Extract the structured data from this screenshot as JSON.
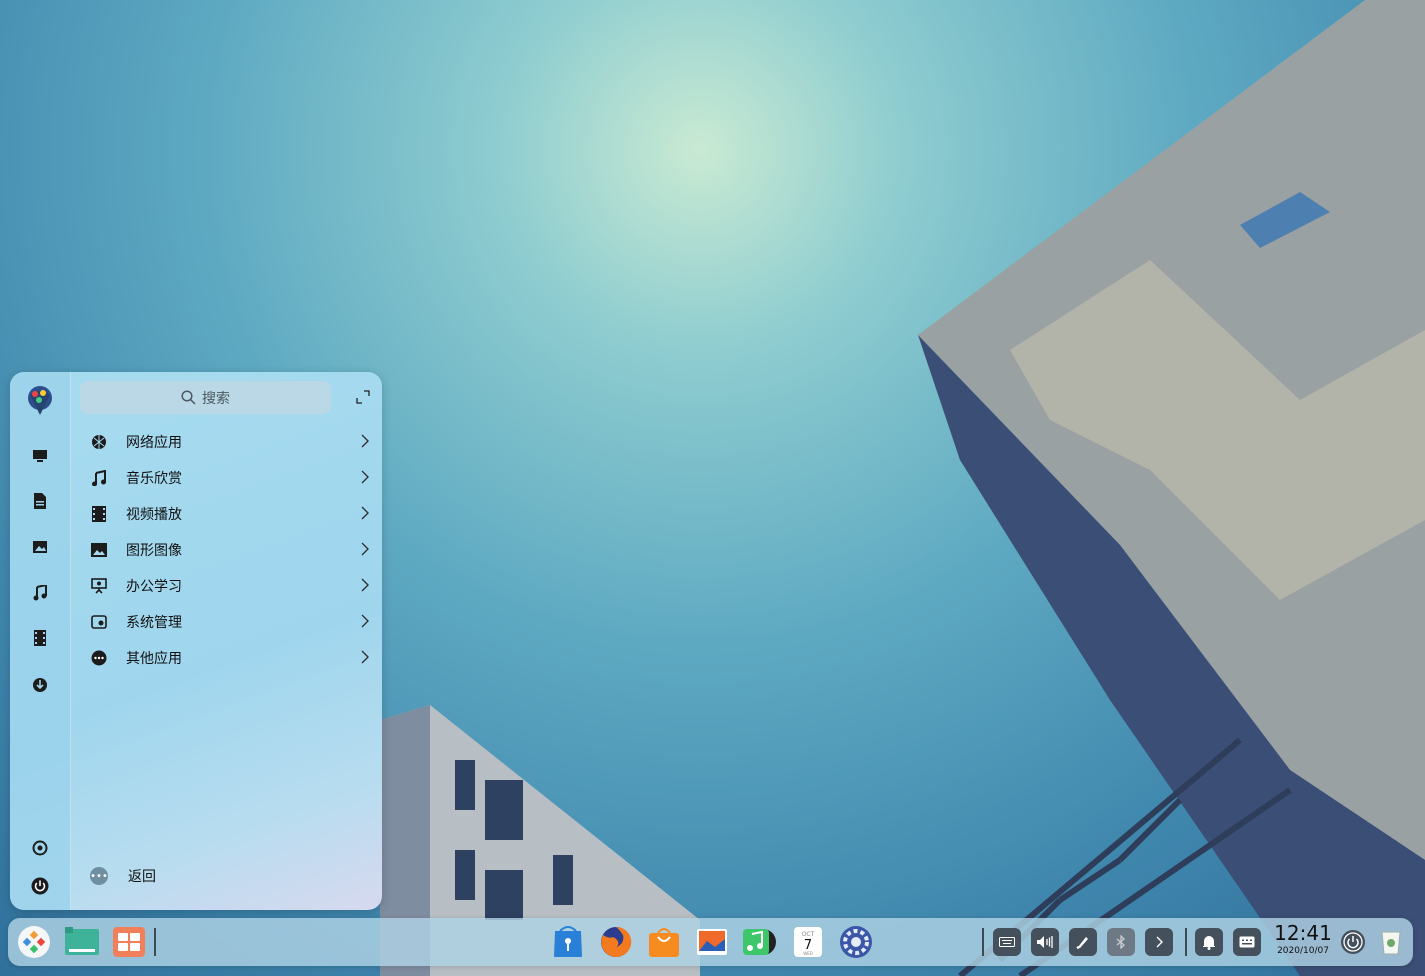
{
  "launcher": {
    "search_placeholder": "搜索",
    "categories": [
      {
        "label": "网络应用",
        "icon": "globe-icon"
      },
      {
        "label": "音乐欣赏",
        "icon": "music-note-icon"
      },
      {
        "label": "视频播放",
        "icon": "film-icon"
      },
      {
        "label": "图形图像",
        "icon": "image-icon"
      },
      {
        "label": "办公学习",
        "icon": "presentation-icon"
      },
      {
        "label": "系统管理",
        "icon": "system-settings-icon"
      },
      {
        "label": "其他应用",
        "icon": "more-dots-icon"
      }
    ],
    "back_label": "返回",
    "sidebar": [
      "computer-icon",
      "document-icon",
      "picture-icon",
      "music-icon",
      "video-icon",
      "download-icon",
      "settings-icon",
      "power-icon"
    ]
  },
  "taskbar": {
    "apps_left": [
      "launcher-icon",
      "file-manager-icon",
      "multitask-view-icon"
    ],
    "apps_center": [
      "app-store-icon",
      "firefox-icon",
      "shopping-bag-icon",
      "image-viewer-icon",
      "music-player-icon",
      "calendar-icon",
      "system-settings-icon"
    ],
    "calendar": {
      "month": "OCT",
      "day": "7",
      "weekday": "WED"
    },
    "tray": [
      "keyboard-icon",
      "volume-icon",
      "pen-icon",
      "bluetooth-icon",
      "chevron-right-icon",
      "notification-bell-icon",
      "keyboard-layout-icon"
    ],
    "time": "12:41",
    "date": "2020/10/07"
  },
  "colors": {
    "accent": "#3fb39a",
    "dark": "#44515c"
  }
}
